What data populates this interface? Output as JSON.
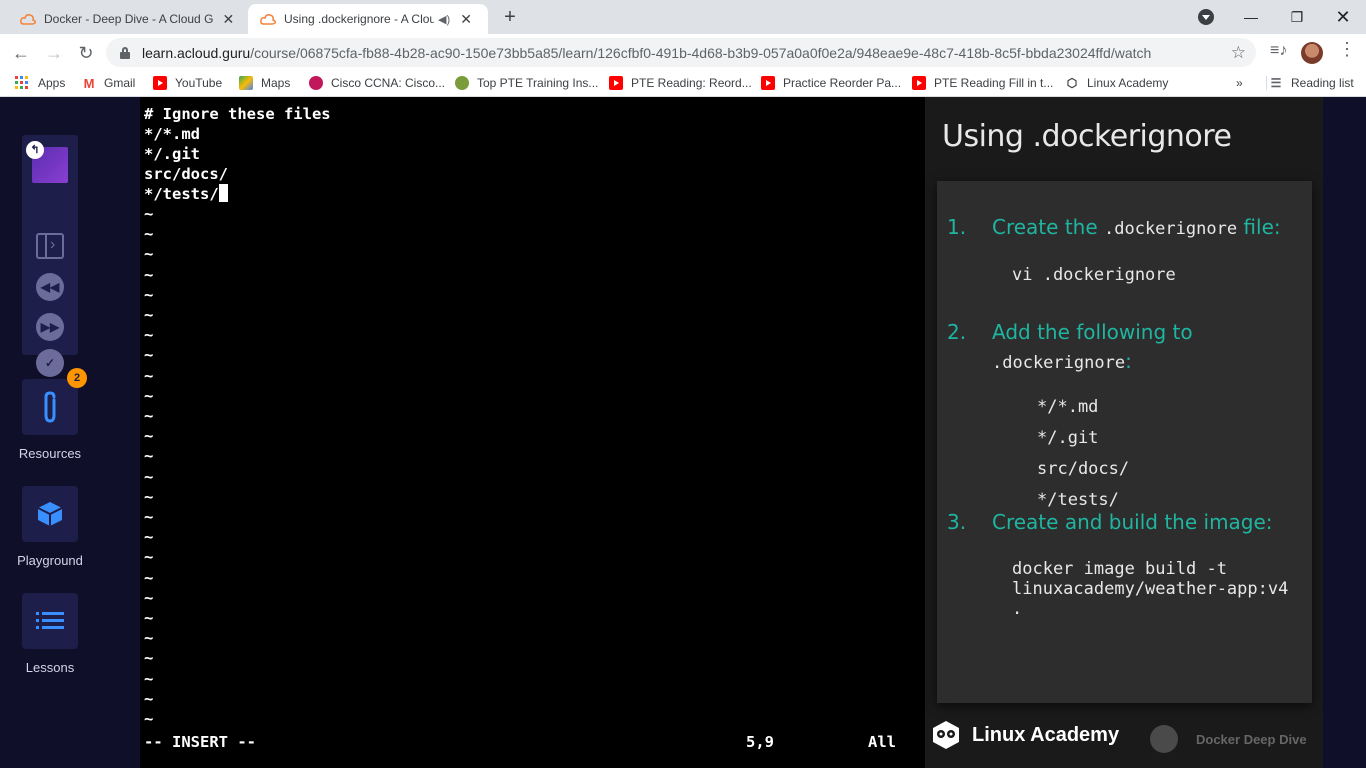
{
  "browser": {
    "tabs": [
      {
        "title": "Docker - Deep Dive - A Cloud Gu",
        "active": false
      },
      {
        "title": "Using .dockerignore - A Clou",
        "active": true
      }
    ],
    "url_host": "learn.acloud.guru",
    "url_path": "/course/06875cfa-fb88-4b28-ac90-150e73bb5a85/learn/126cfbf0-491b-4d68-b3b9-057a0a0f0e2a/948eae9e-48c7-418b-8c5f-bbda23024ffd/watch",
    "bookmarks": [
      {
        "label": "Apps",
        "icon": "apps-grid-icon"
      },
      {
        "label": "Gmail",
        "icon": "gmail-icon"
      },
      {
        "label": "YouTube",
        "icon": "youtube-icon"
      },
      {
        "label": "Maps",
        "icon": "maps-icon"
      },
      {
        "label": "Cisco CCNA: Cisco...",
        "icon": "cisco-icon"
      },
      {
        "label": "Top PTE Training Ins...",
        "icon": "pte-icon"
      },
      {
        "label": "PTE Reading: Reord...",
        "icon": "youtube-icon"
      },
      {
        "label": "Practice Reorder Pa...",
        "icon": "youtube-icon"
      },
      {
        "label": "PTE Reading Fill in t...",
        "icon": "youtube-icon"
      },
      {
        "label": "Linux Academy",
        "icon": "linux-academy-icon"
      }
    ],
    "bookmarks_overflow": "»",
    "reading_list": "Reading list"
  },
  "sidebar": {
    "resources_label": "Resources",
    "resources_badge": "2",
    "playground_label": "Playground",
    "lessons_label": "Lessons"
  },
  "terminal": {
    "lines": [
      "# Ignore these files",
      "*/*.md",
      "*/.git",
      "src/docs/",
      "*/tests/"
    ],
    "tilde": "~",
    "tilde_count": 26,
    "mode": "-- INSERT --",
    "position": "5,9",
    "scroll": "All"
  },
  "slide": {
    "title": "Using .dockerignore",
    "step1_num": "1.",
    "step1_text_a": "Create the ",
    "step1_code": ".dockerignore",
    "step1_text_b": " file:",
    "step1_cmd": "vi .dockerignore",
    "step2_num": "2.",
    "step2_text": "Add the following to",
    "step2_code": ".dockerignore",
    "step2_colon": ":",
    "step2_items": [
      "*/*.md",
      "*/.git",
      "src/docs/",
      "*/tests/"
    ],
    "step3_num": "3.",
    "step3_text": "Create and build the image:",
    "step3_cmd_1": "docker image build -t",
    "step3_cmd_2": "linuxacademy/weather-app:v4",
    "step3_cmd_3": ".",
    "brand": "Linux Academy",
    "course_brand": "Docker Deep Dive"
  }
}
